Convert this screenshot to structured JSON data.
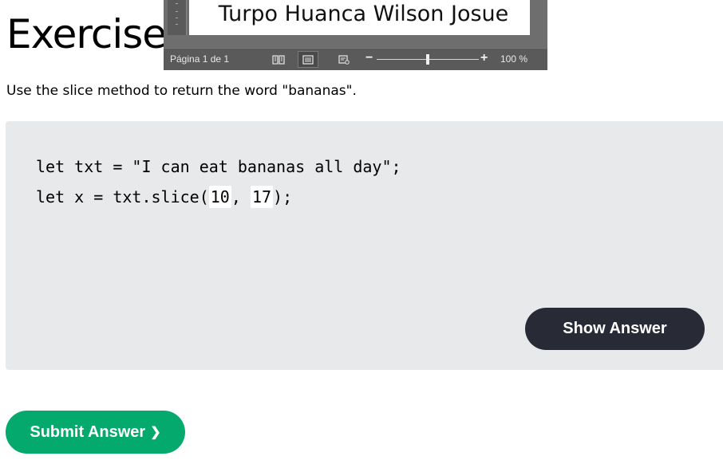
{
  "page": {
    "title": "Exercise:",
    "instruction": "Use the slice method to return the word \"bananas\"."
  },
  "word_window": {
    "document_text": "Turpo Huanca Wilson Josue",
    "page_count": "Página 1 de 1",
    "zoom_level": "100 %",
    "zoom_fraction": 0.5,
    "icons": [
      "read-mode-icon",
      "print-layout-icon",
      "web-layout-icon"
    ],
    "zoom_minus": "−",
    "zoom_plus": "+"
  },
  "code": {
    "line1": "let txt = \"I can eat bananas all day\";",
    "line2_prefix": "let x = txt.slice(",
    "arg1": "10",
    "separator": ", ",
    "arg2": "17",
    "line2_suffix": ");"
  },
  "buttons": {
    "show_answer": "Show Answer",
    "submit_answer": "Submit Answer",
    "submit_chevron": "❯"
  },
  "colors": {
    "code_bg": "#e7e9eb",
    "show_answer_bg": "#282a35",
    "submit_bg": "#04aa6d"
  }
}
